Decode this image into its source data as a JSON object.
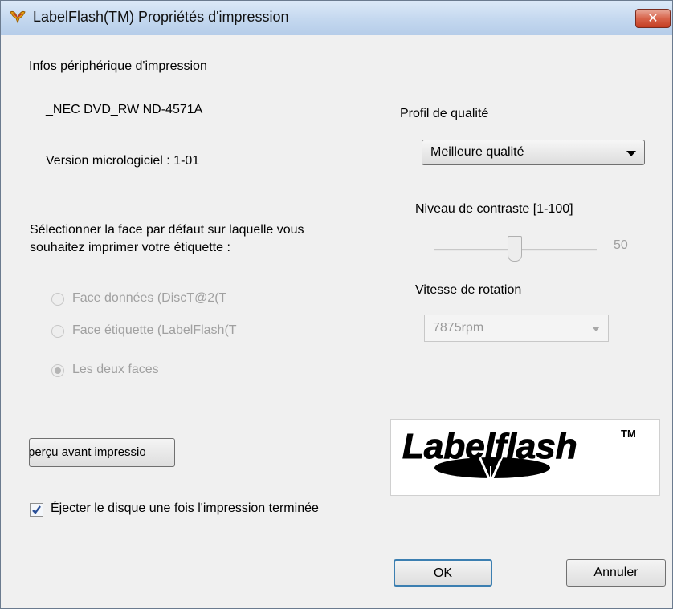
{
  "window": {
    "title": "LabelFlash(TM) Propriétés d'impression",
    "close_symbol": "✕"
  },
  "device": {
    "section_label": "Infos périphérique d'impression",
    "name": "_NEC DVD_RW ND-4571A",
    "firmware": "Version micrologiciel : 1-01"
  },
  "face": {
    "prompt_line1": "Sélectionner la face par défaut sur laquelle vous",
    "prompt_line2": "souhaitez imprimer votre étiquette :",
    "options": [
      {
        "label": "Face données (DiscT@2(T",
        "checked": false
      },
      {
        "label": "Face étiquette (LabelFlash(T",
        "checked": false
      },
      {
        "label": "Les deux faces",
        "checked": true
      }
    ]
  },
  "quality": {
    "label": "Profil de qualité",
    "selected": "Meilleure qualité"
  },
  "contrast": {
    "label": "Niveau de contraste [1-100]",
    "value": "50",
    "level_fraction": 0.5
  },
  "rotation": {
    "label": "Vitesse de rotation",
    "selected": "7875rpm"
  },
  "preview_button": "perçu avant impressio",
  "eject": {
    "label": "Éjecter le disque une fois l'impression terminée",
    "checked": true
  },
  "logo": {
    "text": "Labelflash",
    "trademark": "TM"
  },
  "buttons": {
    "ok": "OK",
    "cancel": "Annuler"
  },
  "colors": {
    "titlebar": "#c4d8ef",
    "close_button": "#c43d22",
    "ok_border": "#3c7fb1",
    "checkmark": "#2a4f97"
  }
}
